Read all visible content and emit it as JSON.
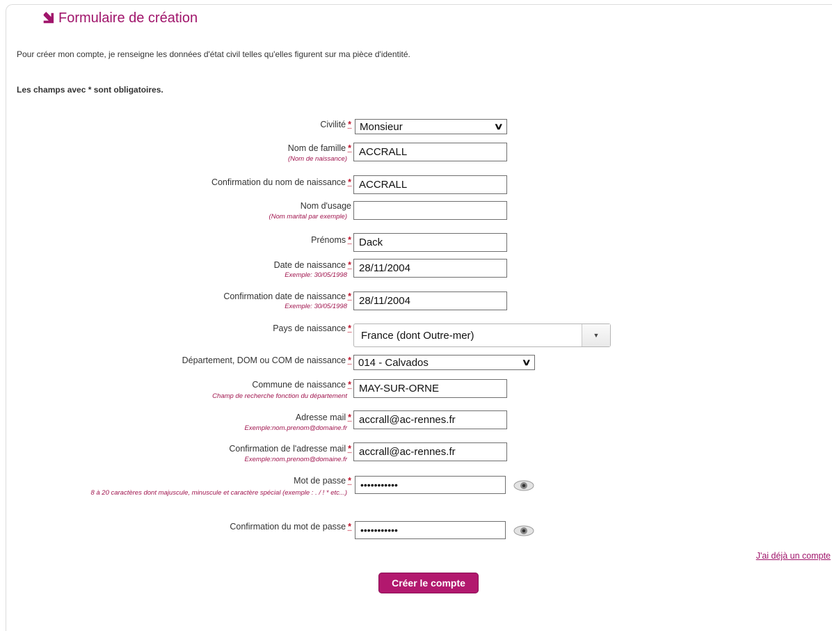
{
  "header": {
    "title": "Formulaire de création"
  },
  "intro": "Pour créer mon compte, je renseigne les données d'état civil telles qu'elles figurent sur ma pièce d'identité.",
  "mandatory_note": "Les champs avec * sont obligatoires.",
  "required_marker": "*",
  "fields": {
    "civilite": {
      "label": "Civilité",
      "value": "Monsieur"
    },
    "nom_famille": {
      "label": "Nom de famille",
      "hint": "(Nom de naissance)",
      "value": "ACCRALL"
    },
    "confirm_nom": {
      "label": "Confirmation du nom de naissance",
      "value": "ACCRALL"
    },
    "nom_usage": {
      "label": "Nom d'usage",
      "hint": "(Nom marital par exemple)",
      "value": ""
    },
    "prenoms": {
      "label": "Prénoms",
      "value": "Dack"
    },
    "date_naissance": {
      "label": "Date de naissance",
      "hint": "Exemple: 30/05/1998",
      "value": "28/11/2004"
    },
    "confirm_date": {
      "label": "Confirmation date de naissance",
      "hint": "Exemple: 30/05/1998",
      "value": "28/11/2004"
    },
    "pays": {
      "label": "Pays de naissance",
      "value": "France (dont Outre-mer)"
    },
    "departement": {
      "label": "Département, DOM ou COM de naissance",
      "value": "014 - Calvados"
    },
    "commune": {
      "label": "Commune de naissance",
      "hint": "Champ de recherche fonction du département",
      "value": "MAY-SUR-ORNE"
    },
    "email": {
      "label": "Adresse mail",
      "hint": "Exemple:nom.prenom@domaine.fr",
      "value": "accrall@ac-rennes.fr"
    },
    "confirm_email": {
      "label": "Confirmation de l'adresse mail",
      "hint": "Exemple:nom.prenom@domaine.fr",
      "value": "accrall@ac-rennes.fr"
    },
    "password": {
      "label": "Mot de passe",
      "hint": "8 à 20 caractères dont majuscule, minuscule et caractère spécial (exemple : . / ! * etc...)",
      "value": "•••••••••••"
    },
    "confirm_password": {
      "label": "Confirmation du mot de passe",
      "value": "•••••••••••"
    }
  },
  "links": {
    "already_account": "J'ai déjà un compte"
  },
  "actions": {
    "submit": "Créer le compte"
  },
  "icons": {
    "title": "arrow-down-right-icon",
    "show_password": "eye-icon"
  },
  "colors": {
    "accent": "#a0156b",
    "button": "#b2186e",
    "hint": "#a0154e",
    "required": "#c0172f"
  }
}
